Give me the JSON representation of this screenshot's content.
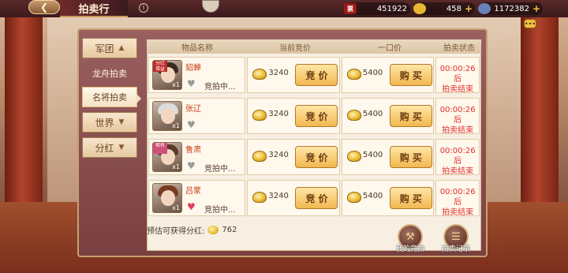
{
  "header": {
    "back_icon": "back-arrow-icon",
    "title": "拍卖行",
    "info_icon": "info-icon"
  },
  "resources": [
    {
      "icon": "yuanbao-ticket-icon",
      "icon_text": "票",
      "value": "451922",
      "add": ""
    },
    {
      "icon": "gold-coin-icon",
      "icon_text": "",
      "value": "458",
      "add": "+"
    },
    {
      "icon": "silver-coin-icon",
      "icon_text": "",
      "value": "1172382",
      "add": "+"
    }
  ],
  "tabs": {
    "legion": "军团",
    "dragon_boat": "龙舟拍卖",
    "famous_general": "名将拍卖",
    "world": "世界",
    "dividend": "分红"
  },
  "table": {
    "headers": [
      "物品名称",
      "当前竞价",
      "一口价",
      "拍卖状态"
    ],
    "rows": [
      {
        "name": "貂蝉",
        "tag": "分红\n增益",
        "count": "x1",
        "liked": false,
        "status": "竞拍中...",
        "current_bid": "3240",
        "bid_label": "竞 价",
        "buyout": "5400",
        "buyout_label": "购 买",
        "timer": "00:00:26后",
        "timer_suffix": "拍卖结束"
      },
      {
        "name": "张辽",
        "tag": "",
        "count": "x1",
        "liked": false,
        "status": "",
        "current_bid": "3240",
        "bid_label": "竞 价",
        "buyout": "5400",
        "buyout_label": "购 买",
        "timer": "00:00:26后",
        "timer_suffix": "拍卖结束"
      },
      {
        "name": "鲁肃",
        "tag": "稀有",
        "count": "x1",
        "liked": false,
        "status": "竞拍中...",
        "current_bid": "3240",
        "bid_label": "竞 价",
        "buyout": "5400",
        "buyout_label": "购 买",
        "timer": "00:00:26后",
        "timer_suffix": "拍卖结束"
      },
      {
        "name": "吕蒙",
        "tag": "",
        "count": "x1",
        "liked": true,
        "status": "竞拍中...",
        "current_bid": "3240",
        "bid_label": "竞 价",
        "buyout": "5400",
        "buyout_label": "购 买",
        "timer": "00:00:26后",
        "timer_suffix": "拍卖结束"
      }
    ]
  },
  "footer": {
    "estimate_label": "预估可获得分红:",
    "estimate_value": "762",
    "my_bids": "我的竞拍",
    "auction_records": "拍卖记录"
  }
}
